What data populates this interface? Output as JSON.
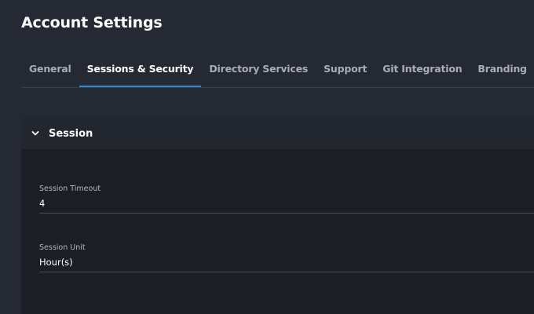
{
  "page": {
    "title": "Account Settings"
  },
  "tabs": [
    {
      "label": "General",
      "active": false
    },
    {
      "label": "Sessions & Security",
      "active": true
    },
    {
      "label": "Directory Services",
      "active": false
    },
    {
      "label": "Support",
      "active": false
    },
    {
      "label": "Git Integration",
      "active": false
    },
    {
      "label": "Branding",
      "active": false
    }
  ],
  "session_panel": {
    "title": "Session",
    "expanded": true,
    "chevron_icon": "chevron-down-icon",
    "fields": [
      {
        "label": "Session Timeout",
        "value": "4"
      },
      {
        "label": "Session Unit",
        "value": "Hour(s)"
      }
    ]
  },
  "colors": {
    "accent": "#2b8be0",
    "background": "#252934",
    "panel": "#1b1e25"
  }
}
